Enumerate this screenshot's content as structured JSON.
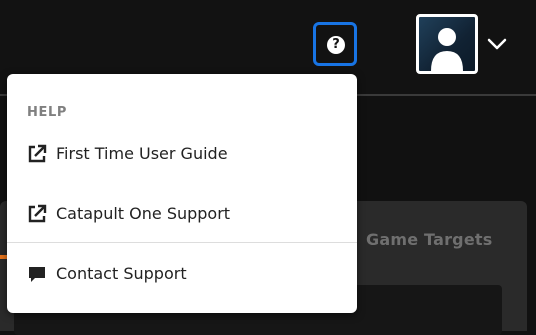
{
  "header": {
    "help_icon": "question-circle-icon",
    "help_glyph": "?",
    "avatar_icon": "user-avatar",
    "menu_chevron_icon": "chevron-down-icon",
    "accent_color": "#1874e4"
  },
  "background": {
    "tab_label": "Game Targets"
  },
  "help_menu": {
    "heading": "HELP",
    "items": [
      {
        "label": "First Time User Guide",
        "icon": "external-link-icon"
      },
      {
        "label": "Catapult One Support",
        "icon": "external-link-icon"
      },
      {
        "label": "Contact Support",
        "icon": "chat-bubble-icon"
      }
    ]
  }
}
